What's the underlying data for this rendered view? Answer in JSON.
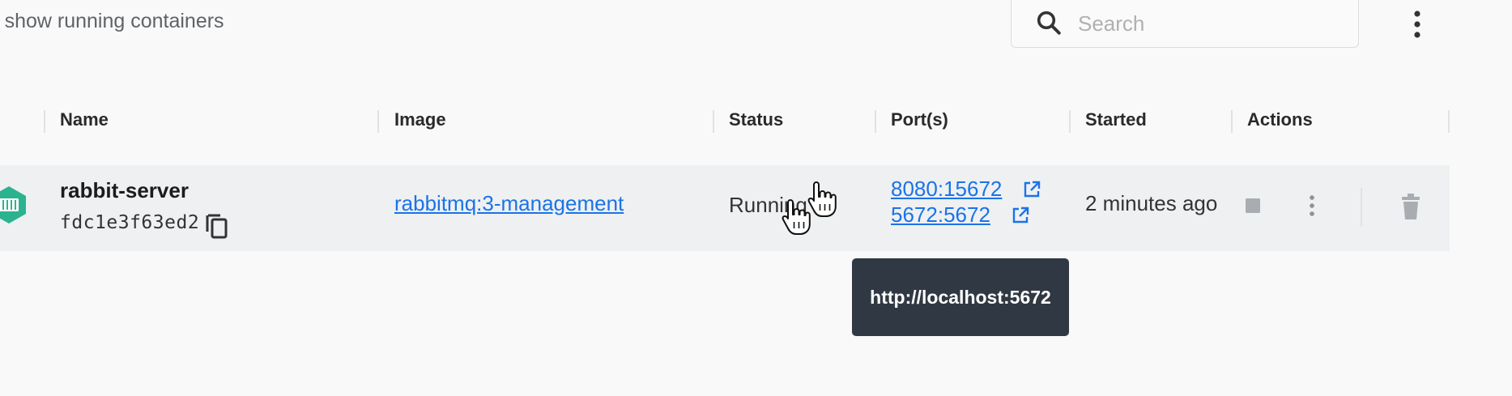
{
  "toolbar": {
    "filter_label": "show running containers",
    "search_placeholder": "Search"
  },
  "table": {
    "columns": [
      "Name",
      "Image",
      "Status",
      "Port(s)",
      "Started",
      "Actions"
    ],
    "rows": [
      {
        "name": "rabbit-server",
        "id": "fdc1e3f63ed2",
        "image": "rabbitmq:3-management",
        "status": "Running",
        "ports": [
          "8080:15672",
          "5672:5672"
        ],
        "started": "2 minutes ago"
      }
    ]
  },
  "tooltip": {
    "text": "http://localhost:5672"
  },
  "colors": {
    "link": "#1a73e8",
    "row_background": "#eef0f2",
    "tooltip_background": "#303943",
    "container_icon": "#2bb38f",
    "action_icon": "#a9adb2"
  }
}
